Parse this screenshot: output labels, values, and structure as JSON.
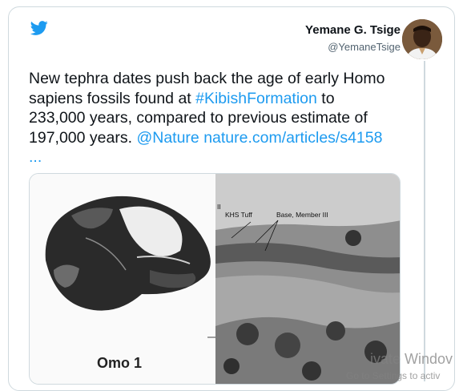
{
  "author": {
    "name": "Yemane G. Tsige",
    "handle": "@YemaneTsige"
  },
  "tweet": {
    "line1": "New tephra dates push back the age of early Homo",
    "line2_a": "sapiens fossils found at ",
    "hashtag": "#KibishFormation",
    "line2_b": " to",
    "line3": "233,000 years, compared to previous estimate of",
    "line4_a": "197,000 years. ",
    "mention": "@Nature",
    "url": "nature.com/articles/s4158",
    "ellipsis": "..."
  },
  "media": {
    "left_caption": "Omo 1",
    "right_labels": {
      "roman": "II",
      "khs": "KHS Tuff",
      "base": "Base, Member III"
    }
  },
  "watermark": {
    "line1": "ivate Windov",
    "line2": "Go to Settings to activ"
  },
  "colors": {
    "twitter_blue": "#1d9bf0",
    "text": "#0f1419",
    "muted": "#536471",
    "border": "#cfd9de"
  },
  "icons": {
    "logo": "twitter-bird-icon"
  }
}
